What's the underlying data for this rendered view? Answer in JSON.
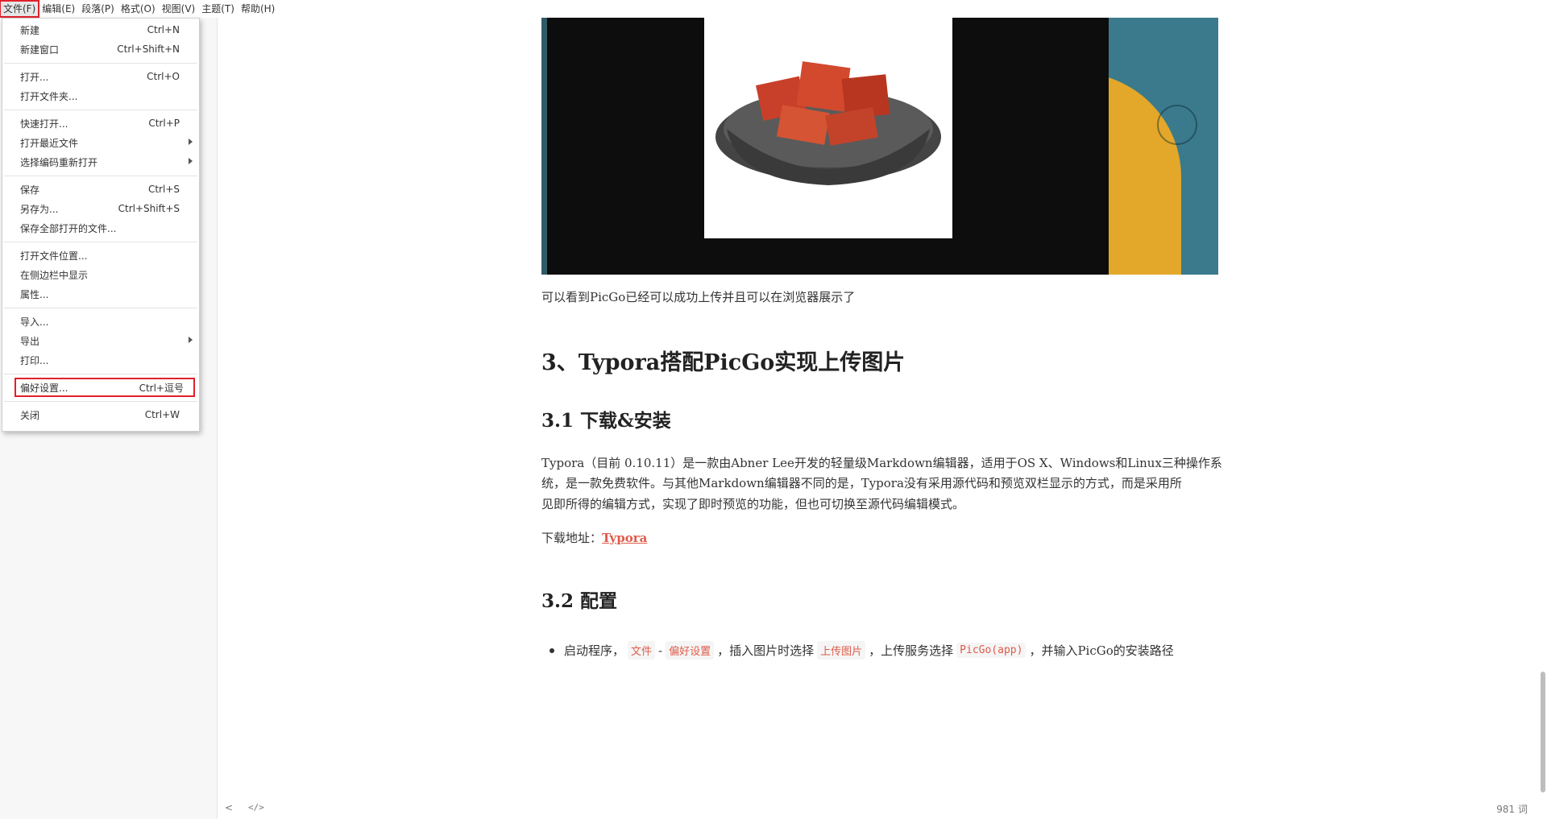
{
  "menubar": {
    "items": [
      "文件(F)",
      "编辑(E)",
      "段落(P)",
      "格式(O)",
      "视图(V)",
      "主题(T)",
      "帮助(H)"
    ]
  },
  "file_menu": {
    "items": [
      {
        "label": "新建",
        "shortcut": "Ctrl+N"
      },
      {
        "label": "新建窗口",
        "shortcut": "Ctrl+Shift+N"
      },
      {
        "label": "打开...",
        "shortcut": "Ctrl+O"
      },
      {
        "label": "打开文件夹...",
        "shortcut": ""
      },
      {
        "label": "快速打开...",
        "shortcut": "Ctrl+P"
      },
      {
        "label": "打开最近文件",
        "shortcut": ""
      },
      {
        "label": "选择编码重新打开",
        "shortcut": ""
      },
      {
        "label": "保存",
        "shortcut": "Ctrl+S"
      },
      {
        "label": "另存为...",
        "shortcut": "Ctrl+Shift+S"
      },
      {
        "label": "保存全部打开的文件...",
        "shortcut": ""
      },
      {
        "label": "打开文件位置...",
        "shortcut": ""
      },
      {
        "label": "在侧边栏中显示",
        "shortcut": ""
      },
      {
        "label": "属性...",
        "shortcut": ""
      },
      {
        "label": "导入...",
        "shortcut": ""
      },
      {
        "label": "导出",
        "shortcut": ""
      },
      {
        "label": "打印...",
        "shortcut": ""
      },
      {
        "label": "偏好设置...",
        "shortcut": "Ctrl+逗号"
      },
      {
        "label": "关闭",
        "shortcut": "Ctrl+W"
      }
    ]
  },
  "doc": {
    "caption": "可以看到PicGo已经可以成功上传并且可以在浏览器展示了",
    "h2": "3、Typora搭配PicGo实现上传图片",
    "h3_1": "3.1 下载&安装",
    "para_line1": "Typora（目前 0.10.11）是一款由Abner Lee开发的轻量级Markdown编辑器，适用于OS X、Windows和Linux三种操作系",
    "para_line2": "统，是一款免费软件。与其他Markdown编辑器不同的是，Typora没有采用源代码和预览双栏显示的方式，而是采用所",
    "para_line3": "见即所得的编辑方式，实现了即时预览的功能，但也可切换至源代码编辑模式。",
    "download_label": "下载地址：",
    "download_link": "Typora",
    "h3_2": "3.2 配置",
    "bullet": {
      "t1": "启动程序，",
      "c1": "文件",
      "sep": "-",
      "c2": "偏好设置",
      "t2": "，插入图片时选择",
      "c3": "上传图片",
      "t3": "，上传服务选择",
      "c4": "PicGo(app)",
      "t4": "，并输入PicGo的安装路径"
    }
  },
  "status": {
    "nav": "<",
    "source": "</>",
    "word_count": "981 词"
  },
  "colors": {
    "highlight_red": "#e0202a",
    "link": "#e05b4a"
  }
}
